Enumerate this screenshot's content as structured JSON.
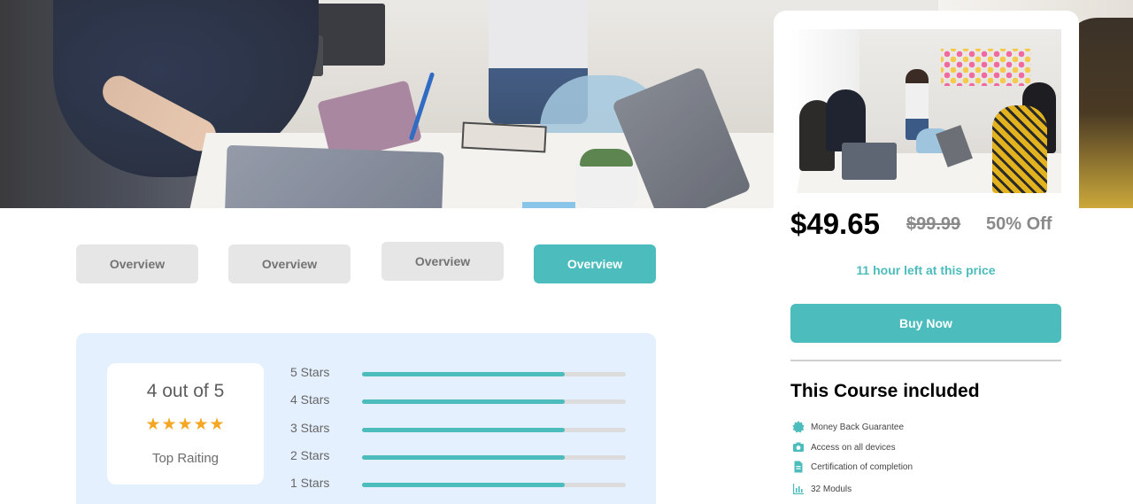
{
  "tabs": [
    {
      "label": "Overview",
      "active": false
    },
    {
      "label": "Overview",
      "active": false
    },
    {
      "label": "Overview",
      "active": false
    },
    {
      "label": "Overview",
      "active": true
    }
  ],
  "rating": {
    "score_text": "4 out of 5",
    "stars": "★★★★★",
    "label": "Top Raiting",
    "bars": [
      {
        "label": "5 Stars",
        "fill": 0.77
      },
      {
        "label": "4 Stars",
        "fill": 0.77
      },
      {
        "label": "3 Stars",
        "fill": 0.77
      },
      {
        "label": "2 Stars",
        "fill": 0.77
      },
      {
        "label": "1 Stars",
        "fill": 0.77
      }
    ]
  },
  "purchase": {
    "price": "$49.65",
    "old_price": "$99.99",
    "discount": "50% Off",
    "time_left": "11 hour left at this price",
    "buy_label": "Buy Now"
  },
  "included": {
    "title": "This Course included",
    "items": [
      {
        "icon": "badge-icon",
        "label": "Money Back Guarantee"
      },
      {
        "icon": "camera-icon",
        "label": "Access on all devices"
      },
      {
        "icon": "document-icon",
        "label": "Certification of completion"
      },
      {
        "icon": "bar-chart-icon",
        "label": "32 Moduls"
      }
    ]
  },
  "colors": {
    "accent": "#4cbcbd",
    "panel": "#e4f0fd",
    "star": "#f5a623",
    "tab_inactive": "#e6e6e6"
  }
}
